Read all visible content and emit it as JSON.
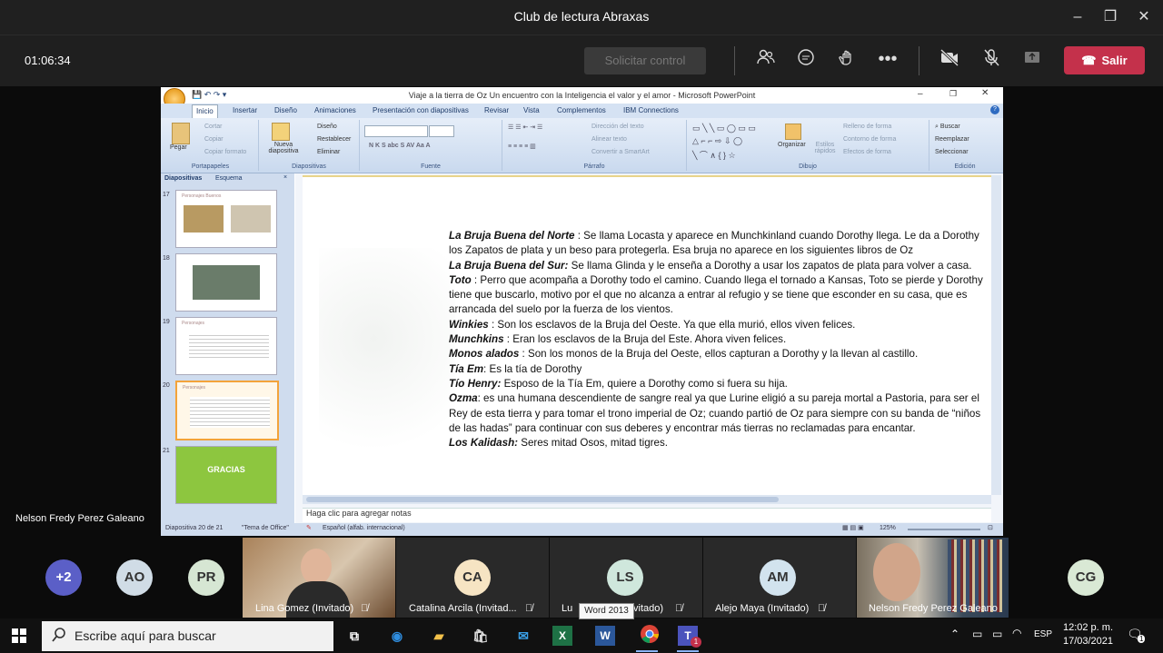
{
  "window": {
    "title": "Club de lectura Abraxas"
  },
  "call": {
    "timer": "01:06:34",
    "request_control": "Solicitar control",
    "leave": "Salir"
  },
  "powerpoint": {
    "title": "Viaje a la tierra de Oz Un encuentro con la Inteligencia el valor y el amor - Microsoft PowerPoint",
    "tabs": [
      "Inicio",
      "Insertar",
      "Diseño",
      "Animaciones",
      "Presentación con diapositivas",
      "Revisar",
      "Vista",
      "Complementos",
      "IBM Connections"
    ],
    "ribbon": {
      "portapapeles": {
        "label": "Portapapeles",
        "pegar": "Pegar",
        "cortar": "Cortar",
        "copiar": "Copiar",
        "copiar_formato": "Copiar formato"
      },
      "diapositivas": {
        "label": "Diapositivas",
        "nueva": "Nueva diapositiva",
        "diseno": "Diseño",
        "restablecer": "Restablecer",
        "eliminar": "Eliminar"
      },
      "fuente": {
        "label": "Fuente"
      },
      "parrafo": {
        "label": "Párrafo",
        "direccion": "Dirección del texto",
        "alinear": "Alinear texto",
        "convertir": "Convertir a SmartArt"
      },
      "dibujo": {
        "label": "Dibujo",
        "organizar": "Organizar",
        "estilos": "Estilos rápidos",
        "relleno": "Relleno de forma",
        "contorno": "Contorno de forma",
        "efectos": "Efectos de forma"
      },
      "edicion": {
        "label": "Edición",
        "buscar": "Buscar",
        "reemplazar": "Reemplazar",
        "seleccionar": "Seleccionar"
      }
    },
    "pane_tabs": [
      "Diapositivas",
      "Esquema"
    ],
    "slides": [
      {
        "num": "17",
        "title": "Personajes Buenos"
      },
      {
        "num": "18",
        "title": ""
      },
      {
        "num": "19",
        "title": "Personajes"
      },
      {
        "num": "20",
        "title": "Personajes"
      },
      {
        "num": "21",
        "title": "GRACIAS"
      }
    ],
    "slide_text": [
      {
        "term": "La Bruja Buena del Norte",
        "text": " : Se llama Locasta y aparece en Munchkinland cuando Dorothy llega. Le da a Dorothy los Zapatos de plata y un beso para protegerla. Esa bruja no aparece en los siguientes libros de Oz"
      },
      {
        "term": " La Bruja Buena del Sur:",
        "text": " Se llama Glinda y le enseña a Dorothy a usar los zapatos de plata para volver a casa."
      },
      {
        "term": "Toto",
        "text": " : Perro que acompaña a Dorothy todo el camino. Cuando llega el tornado a Kansas, Toto se pierde y Dorothy tiene que buscarlo, motivo por el que no alcanza a entrar al refugio y se tiene que esconder en su casa, que es arrancada del suelo por la fuerza de los vientos."
      },
      {
        "term": "Winkies",
        "text": " : Son los esclavos de la Bruja del Oeste. Ya que ella murió, ellos viven felices."
      },
      {
        "term": "Munchkins",
        "text": " : Eran los esclavos de la Bruja del Este. Ahora viven felices."
      },
      {
        "term": "Monos alados",
        "text": " : Son los monos de la Bruja del Oeste, ellos capturan a Dorothy y la llevan al castillo."
      },
      {
        "term": "Tía Em",
        "text": ": Es la tía de Dorothy"
      },
      {
        "term": "Tío Henry:",
        "text": " Esposo de la Tía Em, quiere a Dorothy como si fuera su hija."
      },
      {
        "term": "Ozma",
        "text": ": es una humana descendiente de sangre real ya que Lurine eligió a su pareja mortal a Pastoria, para ser el Rey de esta tierra y para tomar el trono imperial de Oz; cuando partió de Oz para siempre con su banda de “niños de las hadas” para continuar con sus deberes y encontrar más tierras no reclamadas para encantar."
      },
      {
        "term": "Los Kalidash:",
        "text": " Seres mitad Osos, mitad tigres."
      }
    ],
    "notes_placeholder": "Haga clic para agregar notas",
    "status": {
      "slide": "Diapositiva 20 de 21",
      "theme": "\"Tema de Office\"",
      "language": "Español (alfab. internacional)",
      "zoom": "125%"
    }
  },
  "presenter_label": "Nelson Fredy Perez Galeano",
  "participants": {
    "overflow": "+2",
    "initials": [
      {
        "text": "AO",
        "color": "#d0dce6"
      },
      {
        "text": "PR",
        "color": "#d6e6d3"
      },
      {
        "text": "CA",
        "color": "#f6e4c3"
      },
      {
        "text": "LS",
        "color": "#cfe7dc"
      },
      {
        "text": "AM",
        "color": "#d2e3ee"
      },
      {
        "text": "CG",
        "color": "#d9e9d5"
      }
    ],
    "names": {
      "lina": "Lina Gomez (Invitado)",
      "catalina": "Catalina Arcila (Invitad...",
      "lu": "Lu",
      "lu_tail": "vitado)",
      "alejo": "Alejo Maya (Invitado)",
      "nelson": "Nelson Fredy Perez Galeano"
    }
  },
  "taskbar": {
    "search_placeholder": "Escribe aquí para buscar",
    "tooltip": "Word 2013",
    "lang": "ESP",
    "time": "12:02 p. m.",
    "date": "17/03/2021",
    "notification_count": "1",
    "teams_badge": "1"
  }
}
